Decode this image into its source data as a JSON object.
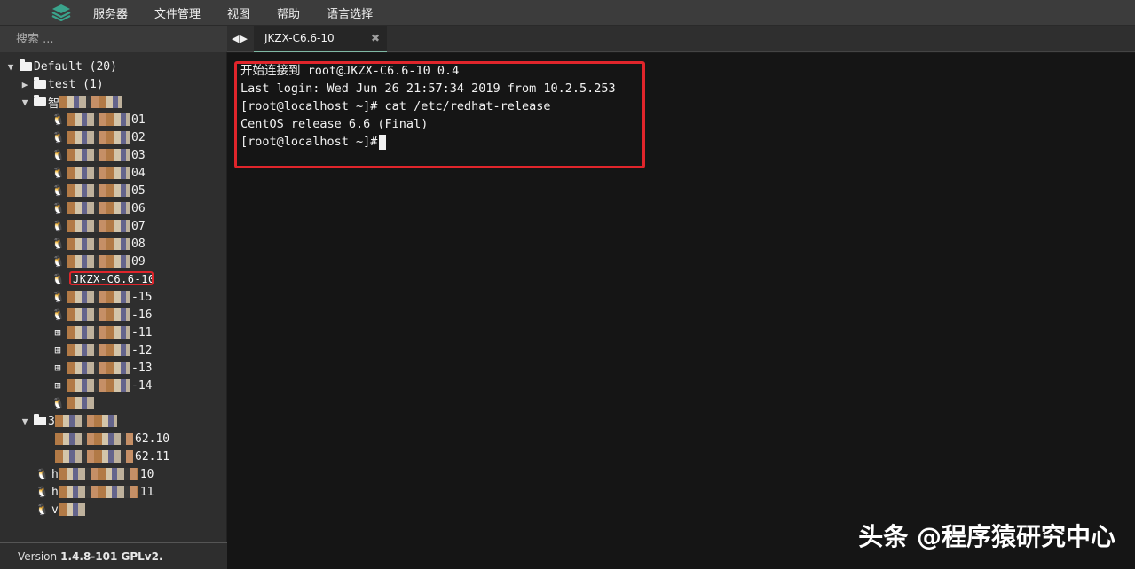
{
  "menubar": {
    "logo_icon": "stack-logo-icon",
    "items": [
      "服务器",
      "文件管理",
      "视图",
      "帮助",
      "语言选择"
    ]
  },
  "sidebar": {
    "search_placeholder": "搜索 ...",
    "tree": {
      "default_group": "Default (20)",
      "test_folder": "test (1)",
      "group2_label": "智",
      "hosts_suffix": [
        "01",
        "02",
        "03",
        "04",
        "05",
        "06",
        "07",
        "08",
        "09"
      ],
      "selected_host": "JKZX-C6.6-10",
      "hosts_suffix_b": [
        "-15",
        "-16"
      ],
      "win_hosts_suffix": [
        "-11",
        "-12",
        "-13",
        "-14"
      ],
      "group3_label": "3",
      "group3_hosts_suffix": [
        "62.10",
        "62.11"
      ],
      "root_hosts": [
        "h",
        "h",
        "v"
      ],
      "root_hosts_suffix": [
        "10",
        "11",
        ""
      ]
    },
    "version_label": "Version",
    "version_value": "1.4.8-101 GPLv2."
  },
  "tabs": {
    "active_title": "JKZX-C6.6-10",
    "close_glyph": "✖"
  },
  "terminal": {
    "lines": [
      "开始连接到 root@JKZX-C6.6-10 0.4",
      "Last login: Wed Jun 26 21:57:34 2019 from 10.2.5.253",
      "[root@localhost ~]# cat /etc/redhat-release",
      "CentOS release 6.6 (Final)",
      "[root@localhost ~]#"
    ]
  },
  "watermark": "头条 @程序猿研究中心",
  "colors": {
    "accent_red": "#e0252b",
    "tab_underline": "#7fb8a4",
    "logo_teal": "#3aa48c"
  }
}
